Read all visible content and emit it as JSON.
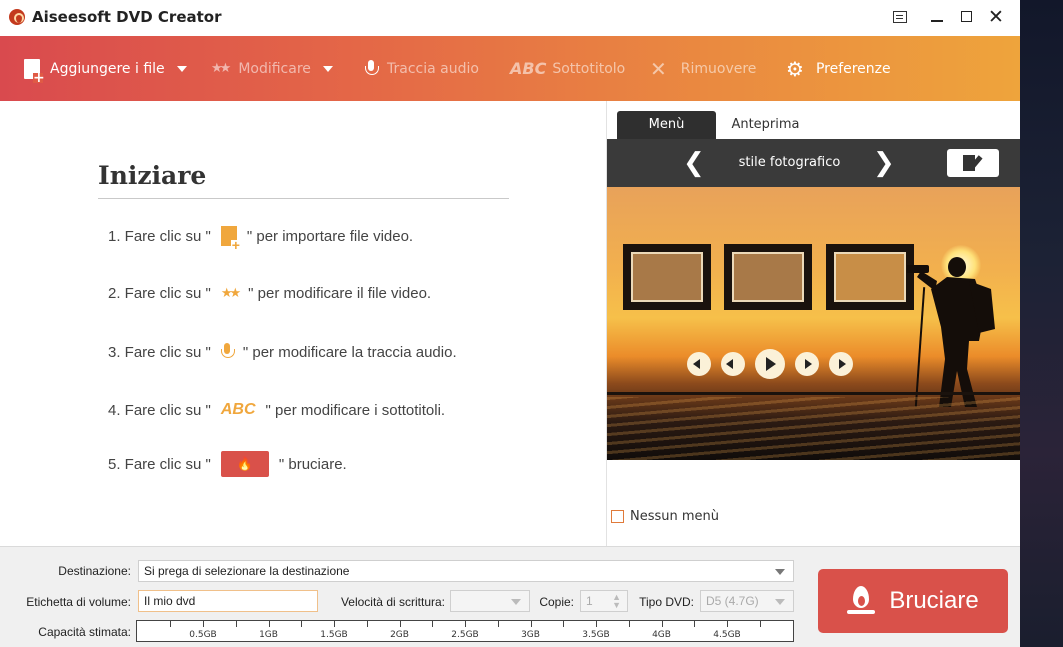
{
  "window": {
    "title": "Aiseesoft DVD Creator"
  },
  "toolbar": {
    "add_files": "Aggiungere i file",
    "edit": "Modificare",
    "audio_track": "Traccia audio",
    "subtitle_abc": "ABC",
    "subtitle": "Sottotitolo",
    "remove": "Rimuovere",
    "preferences": "Preferenze",
    "stars_glyph": "★★",
    "remove_glyph": "✕",
    "gear_glyph": "⚙"
  },
  "guide": {
    "title": "Iniziare",
    "steps": [
      {
        "prefix": "1. Fare clic su \"",
        "suffix": "\" per importare file video.",
        "icon": "add-file-icon"
      },
      {
        "prefix": "2. Fare clic su \"",
        "suffix": "\" per modificare il file video.",
        "icon": "edit-stars-icon"
      },
      {
        "prefix": "3. Fare clic su \"",
        "suffix": "\" per modificare la traccia audio.",
        "icon": "microphone-icon"
      },
      {
        "prefix": "4. Fare clic su \"",
        "suffix": "\" per modificare i sottotitoli.",
        "icon": "abc-subtitle-icon"
      },
      {
        "prefix": "5. Fare clic su \"",
        "suffix": "\" bruciare.",
        "icon": "burn-flame-icon"
      }
    ],
    "abc": "ABC",
    "stars": "★★",
    "flame": "🔥"
  },
  "panel": {
    "tab_menu": "Menù",
    "tab_preview": "Anteprima",
    "style_name": "stile fotografico",
    "prev_glyph": "❮",
    "next_glyph": "❯",
    "no_menu": "Nessun menù"
  },
  "bottom": {
    "destination_label": "Destinazione:",
    "destination_value": "Si prega di selezionare la destinazione",
    "volume_label": "Etichetta di volume:",
    "volume_value": "Il mio dvd",
    "speed_label": "Velocità di scrittura:",
    "speed_value": "",
    "copies_label": "Copie:",
    "copies_value": "1",
    "dvd_type_label": "Tipo DVD:",
    "dvd_type_value": "D5 (4.7G)",
    "capacity_label": "Capacità stimata:",
    "capacity_ticks": [
      "0.5GB",
      "1GB",
      "1.5GB",
      "2GB",
      "2.5GB",
      "3GB",
      "3.5GB",
      "4GB",
      "4.5GB"
    ],
    "burn_label": "Bruciare"
  },
  "colors": {
    "accent_red": "#d9514a",
    "accent_orange": "#eea43c",
    "icon_orange": "#f0a73d"
  }
}
